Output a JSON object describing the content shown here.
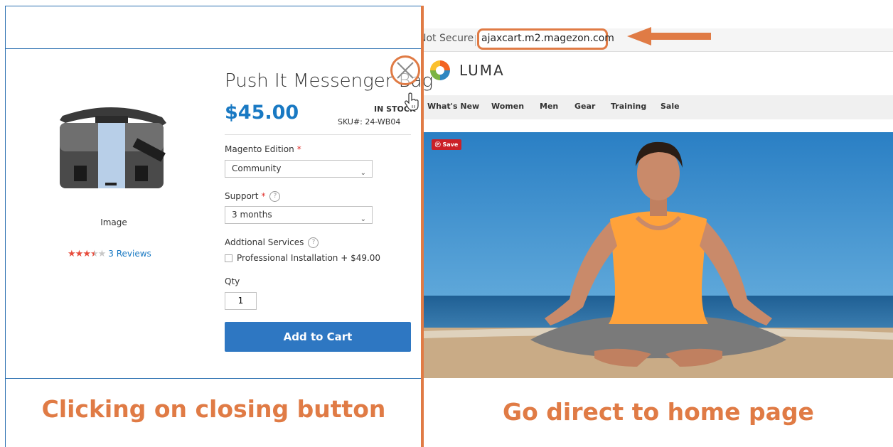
{
  "modal": {
    "image_label": "Image",
    "rating": {
      "stars_filled": 3.5,
      "stars_total": 5,
      "reviews_label": "3 Reviews"
    },
    "product_title": "Push It Messenger Bag",
    "price": "$45.00",
    "stock": "IN STOCK",
    "sku": "SKU#:  24-WB04",
    "options": {
      "edition": {
        "label": "Magento Edition",
        "value": "Community"
      },
      "support": {
        "label": "Support",
        "value": "3 months"
      },
      "services": {
        "label": "Addtional Services",
        "checkbox_label": "Professional Installation + $49.00"
      },
      "qty": {
        "label": "Qty",
        "value": "1"
      }
    },
    "add_to_cart_label": "Add to Cart",
    "help_glyph": "?",
    "required_glyph": "*"
  },
  "left_caption": "Clicking on closing button",
  "browser": {
    "security_label": "Not Secure",
    "url": "ajaxcart.m2.magezon.com"
  },
  "site": {
    "logo_text": "LUMA",
    "nav": [
      "What's New",
      "Women",
      "Men",
      "Gear",
      "Training",
      "Sale"
    ],
    "pin_save_label": "Save"
  },
  "right_caption": "Go direct to home page",
  "colors": {
    "accent_orange": "#e07b45",
    "link_blue": "#1979c3",
    "button_blue": "#2e77c2",
    "star_red": "#e74c3c",
    "required_red": "#e02b27"
  },
  "icons": [
    "close-icon",
    "pointer-hand-icon",
    "chevron-down-icon",
    "help-icon",
    "arrow-left-icon",
    "luma-logo-icon",
    "pinterest-icon"
  ]
}
